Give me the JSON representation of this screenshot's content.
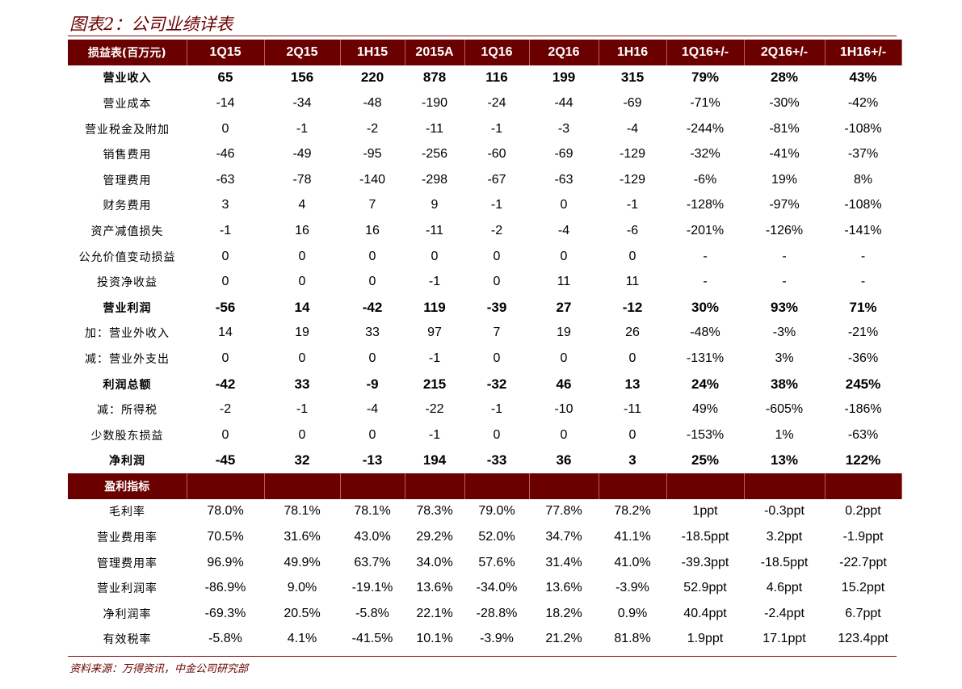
{
  "title": "图表2：公司业绩详表",
  "source": "资料来源：万得资讯，中金公司研究部",
  "colors": {
    "header_bg": "#6b0000",
    "header_text": "#ffffff",
    "title_text": "#6b0000"
  },
  "table": {
    "headers": [
      "损益表(百万元)",
      "1Q15",
      "2Q15",
      "1H15",
      "2015A",
      "1Q16",
      "2Q16",
      "1H16",
      "1Q16+/-",
      "2Q16+/-",
      "1H16+/-"
    ],
    "rows": [
      {
        "bold": true,
        "label": "营业收入",
        "values": [
          "65",
          "156",
          "220",
          "878",
          "116",
          "199",
          "315",
          "79%",
          "28%",
          "43%"
        ]
      },
      {
        "bold": false,
        "label": "营业成本",
        "values": [
          "-14",
          "-34",
          "-48",
          "-190",
          "-24",
          "-44",
          "-69",
          "-71%",
          "-30%",
          "-42%"
        ]
      },
      {
        "bold": false,
        "label": "营业税金及附加",
        "values": [
          "0",
          "-1",
          "-2",
          "-11",
          "-1",
          "-3",
          "-4",
          "-244%",
          "-81%",
          "-108%"
        ]
      },
      {
        "bold": false,
        "label": "销售费用",
        "values": [
          "-46",
          "-49",
          "-95",
          "-256",
          "-60",
          "-69",
          "-129",
          "-32%",
          "-41%",
          "-37%"
        ]
      },
      {
        "bold": false,
        "label": "管理费用",
        "values": [
          "-63",
          "-78",
          "-140",
          "-298",
          "-67",
          "-63",
          "-129",
          "-6%",
          "19%",
          "8%"
        ]
      },
      {
        "bold": false,
        "label": "财务费用",
        "values": [
          "3",
          "4",
          "7",
          "9",
          "-1",
          "0",
          "-1",
          "-128%",
          "-97%",
          "-108%"
        ]
      },
      {
        "bold": false,
        "label": "资产减值损失",
        "values": [
          "-1",
          "16",
          "16",
          "-11",
          "-2",
          "-4",
          "-6",
          "-201%",
          "-126%",
          "-141%"
        ]
      },
      {
        "bold": false,
        "label": "公允价值变动损益",
        "values": [
          "0",
          "0",
          "0",
          "0",
          "0",
          "0",
          "0",
          "-",
          "-",
          "-"
        ]
      },
      {
        "bold": false,
        "label": "投资净收益",
        "values": [
          "0",
          "0",
          "0",
          "-1",
          "0",
          "11",
          "11",
          "-",
          "-",
          "-"
        ]
      },
      {
        "bold": true,
        "label": "营业利润",
        "values": [
          "-56",
          "14",
          "-42",
          "119",
          "-39",
          "27",
          "-12",
          "30%",
          "93%",
          "71%"
        ]
      },
      {
        "bold": false,
        "label": "加：营业外收入",
        "values": [
          "14",
          "19",
          "33",
          "97",
          "7",
          "19",
          "26",
          "-48%",
          "-3%",
          "-21%"
        ]
      },
      {
        "bold": false,
        "label": "减：营业外支出",
        "values": [
          "0",
          "0",
          "0",
          "-1",
          "0",
          "0",
          "0",
          "-131%",
          "3%",
          "-36%"
        ]
      },
      {
        "bold": true,
        "label": "利润总额",
        "values": [
          "-42",
          "33",
          "-9",
          "215",
          "-32",
          "46",
          "13",
          "24%",
          "38%",
          "245%"
        ]
      },
      {
        "bold": false,
        "label": "减：所得税",
        "values": [
          "-2",
          "-1",
          "-4",
          "-22",
          "-1",
          "-10",
          "-11",
          "49%",
          "-605%",
          "-186%"
        ]
      },
      {
        "bold": false,
        "label": "少数股东损益",
        "values": [
          "0",
          "0",
          "0",
          "-1",
          "0",
          "0",
          "0",
          "-153%",
          "1%",
          "-63%"
        ]
      },
      {
        "bold": true,
        "label": "净利润",
        "values": [
          "-45",
          "32",
          "-13",
          "194",
          "-33",
          "36",
          "3",
          "25%",
          "13%",
          "122%"
        ]
      }
    ],
    "section_label": "盈利指标",
    "ratio_rows": [
      {
        "label": "毛利率",
        "values": [
          "78.0%",
          "78.1%",
          "78.1%",
          "78.3%",
          "79.0%",
          "77.8%",
          "78.2%",
          "1ppt",
          "-0.3ppt",
          "0.2ppt"
        ]
      },
      {
        "label": "营业费用率",
        "values": [
          "70.5%",
          "31.6%",
          "43.0%",
          "29.2%",
          "52.0%",
          "34.7%",
          "41.1%",
          "-18.5ppt",
          "3.2ppt",
          "-1.9ppt"
        ]
      },
      {
        "label": "管理费用率",
        "values": [
          "96.9%",
          "49.9%",
          "63.7%",
          "34.0%",
          "57.6%",
          "31.4%",
          "41.0%",
          "-39.3ppt",
          "-18.5ppt",
          "-22.7ppt"
        ]
      },
      {
        "label": "营业利润率",
        "values": [
          "-86.9%",
          "9.0%",
          "-19.1%",
          "13.6%",
          "-34.0%",
          "13.6%",
          "-3.9%",
          "52.9ppt",
          "4.6ppt",
          "15.2ppt"
        ]
      },
      {
        "label": "净利润率",
        "values": [
          "-69.3%",
          "20.5%",
          "-5.8%",
          "22.1%",
          "-28.8%",
          "18.2%",
          "0.9%",
          "40.4ppt",
          "-2.4ppt",
          "6.7ppt"
        ]
      },
      {
        "label": "有效税率",
        "values": [
          "-5.8%",
          "4.1%",
          "-41.5%",
          "10.1%",
          "-3.9%",
          "21.2%",
          "81.8%",
          "1.9ppt",
          "17.1ppt",
          "123.4ppt"
        ]
      }
    ]
  }
}
